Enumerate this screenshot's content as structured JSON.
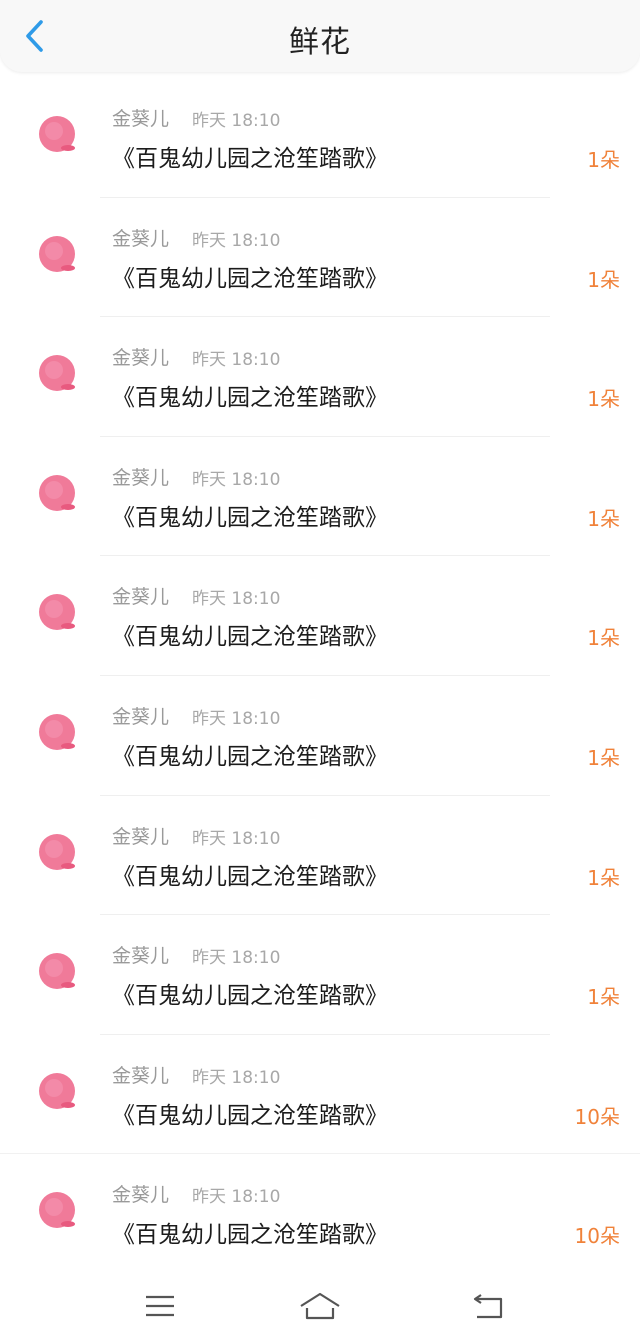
{
  "header": {
    "title": "鲜花"
  },
  "items": [
    {
      "name": "金葵儿",
      "time": "昨天 18:10",
      "work": "《百鬼幼儿园之沧笙踏歌》",
      "count": "1朵"
    },
    {
      "name": "金葵儿",
      "time": "昨天 18:10",
      "work": "《百鬼幼儿园之沧笙踏歌》",
      "count": "1朵"
    },
    {
      "name": "金葵儿",
      "time": "昨天 18:10",
      "work": "《百鬼幼儿园之沧笙踏歌》",
      "count": "1朵"
    },
    {
      "name": "金葵儿",
      "time": "昨天 18:10",
      "work": "《百鬼幼儿园之沧笙踏歌》",
      "count": "1朵"
    },
    {
      "name": "金葵儿",
      "time": "昨天 18:10",
      "work": "《百鬼幼儿园之沧笙踏歌》",
      "count": "1朵"
    },
    {
      "name": "金葵儿",
      "time": "昨天 18:10",
      "work": "《百鬼幼儿园之沧笙踏歌》",
      "count": "1朵"
    },
    {
      "name": "金葵儿",
      "time": "昨天 18:10",
      "work": "《百鬼幼儿园之沧笙踏歌》",
      "count": "1朵"
    },
    {
      "name": "金葵儿",
      "time": "昨天 18:10",
      "work": "《百鬼幼儿园之沧笙踏歌》",
      "count": "1朵"
    },
    {
      "name": "金葵儿",
      "time": "昨天 18:10",
      "work": "《百鬼幼儿园之沧笙踏歌》",
      "count": "10朵"
    },
    {
      "name": "金葵儿",
      "time": "昨天 18:10",
      "work": "《百鬼幼儿园之沧笙踏歌》",
      "count": "10朵"
    }
  ],
  "colors": {
    "accent": "#f0823a",
    "back_arrow": "#2f9be8",
    "avatar": "#ee6b8e"
  },
  "icons": {
    "back": "chevron-left-icon",
    "avatar": "pink-flower-avatar-icon",
    "menu": "menu-lines-icon",
    "home": "home-icon",
    "return": "return-icon"
  }
}
